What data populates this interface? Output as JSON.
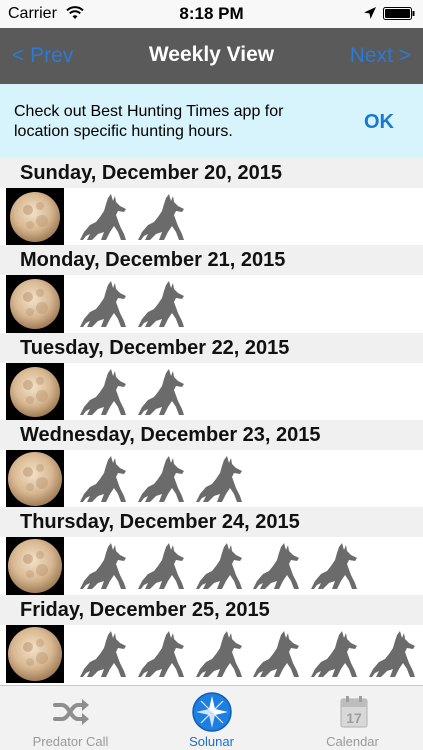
{
  "status_bar": {
    "carrier": "Carrier",
    "time": "8:18 PM"
  },
  "nav": {
    "prev": "< Prev",
    "title": "Weekly View",
    "next": "Next >"
  },
  "banner": {
    "message": "Check out Best Hunting Times app for location specific hunting hours.",
    "ok": "OK"
  },
  "days": [
    {
      "date": "Sunday, December 20, 2015",
      "wolves": 2,
      "moon_phase": "waxing-gibbous"
    },
    {
      "date": "Monday, December 21, 2015",
      "wolves": 2,
      "moon_phase": "waxing-gibbous"
    },
    {
      "date": "Tuesday, December 22, 2015",
      "wolves": 2,
      "moon_phase": "waxing-gibbous"
    },
    {
      "date": "Wednesday, December 23, 2015",
      "wolves": 3,
      "moon_phase": "nearly-full"
    },
    {
      "date": "Thursday, December 24, 2015",
      "wolves": 5,
      "moon_phase": "full"
    },
    {
      "date": "Friday, December 25, 2015",
      "wolves": 6,
      "moon_phase": "full"
    }
  ],
  "tabs": [
    {
      "label": "Predator Call",
      "icon": "shuffle-icon",
      "active": false
    },
    {
      "label": "Solunar",
      "icon": "compass-icon",
      "active": true
    },
    {
      "label": "Calendar",
      "icon": "calendar-icon",
      "active": false
    }
  ],
  "calendar_icon_day": "17",
  "colors": {
    "nav_bg": "#5a5a5a",
    "link_blue": "#2a7ad8",
    "banner_bg": "#d7f3fb",
    "wolf_gray": "#6b6b6b",
    "active_tab": "#1a6fd0"
  }
}
